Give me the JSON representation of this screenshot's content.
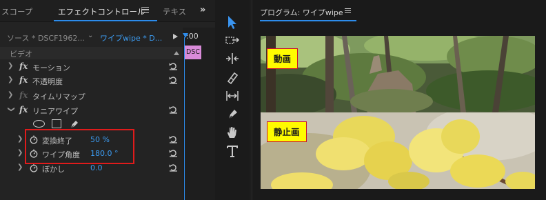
{
  "effect_controls": {
    "tabs": [
      {
        "label": "スコープ"
      },
      {
        "label": "エフェクトコントロール"
      },
      {
        "label": "テキス"
      }
    ],
    "overflow_label": "»",
    "source_label": "ソース * DSCF1962...",
    "sequence_label": "ワイプwipe * D...",
    "timeline": {
      "time_label": ":00",
      "clip_label": "DSC"
    },
    "video_header": "ビデオ",
    "effects": [
      {
        "label": "モーション",
        "enabled": true
      },
      {
        "label": "不透明度",
        "enabled": true
      },
      {
        "label": "タイムリマップ",
        "enabled": false
      },
      {
        "label": "リニアワイプ",
        "enabled": true
      }
    ],
    "params": [
      {
        "label": "変換終了",
        "value": "50 %"
      },
      {
        "label": "ワイプ角度",
        "value": "180.0 °"
      },
      {
        "label": "ぼかし",
        "value": "0.0"
      }
    ],
    "highlight_color": "#e01b1b"
  },
  "tools": [
    {
      "name": "selection-tool",
      "active": true
    },
    {
      "name": "track-select-forward-tool"
    },
    {
      "name": "ripple-edit-tool"
    },
    {
      "name": "razor-tool"
    },
    {
      "name": "slip-tool"
    },
    {
      "name": "pen-tool"
    },
    {
      "name": "hand-tool"
    },
    {
      "name": "type-tool"
    }
  ],
  "program": {
    "title": "プログラム: ワイプwipe",
    "top_caption": "動画",
    "bottom_caption": "静止画",
    "caption_bg": "#fffb00",
    "caption_border": "#c8102e"
  },
  "accent_color": "#2d8ceb"
}
